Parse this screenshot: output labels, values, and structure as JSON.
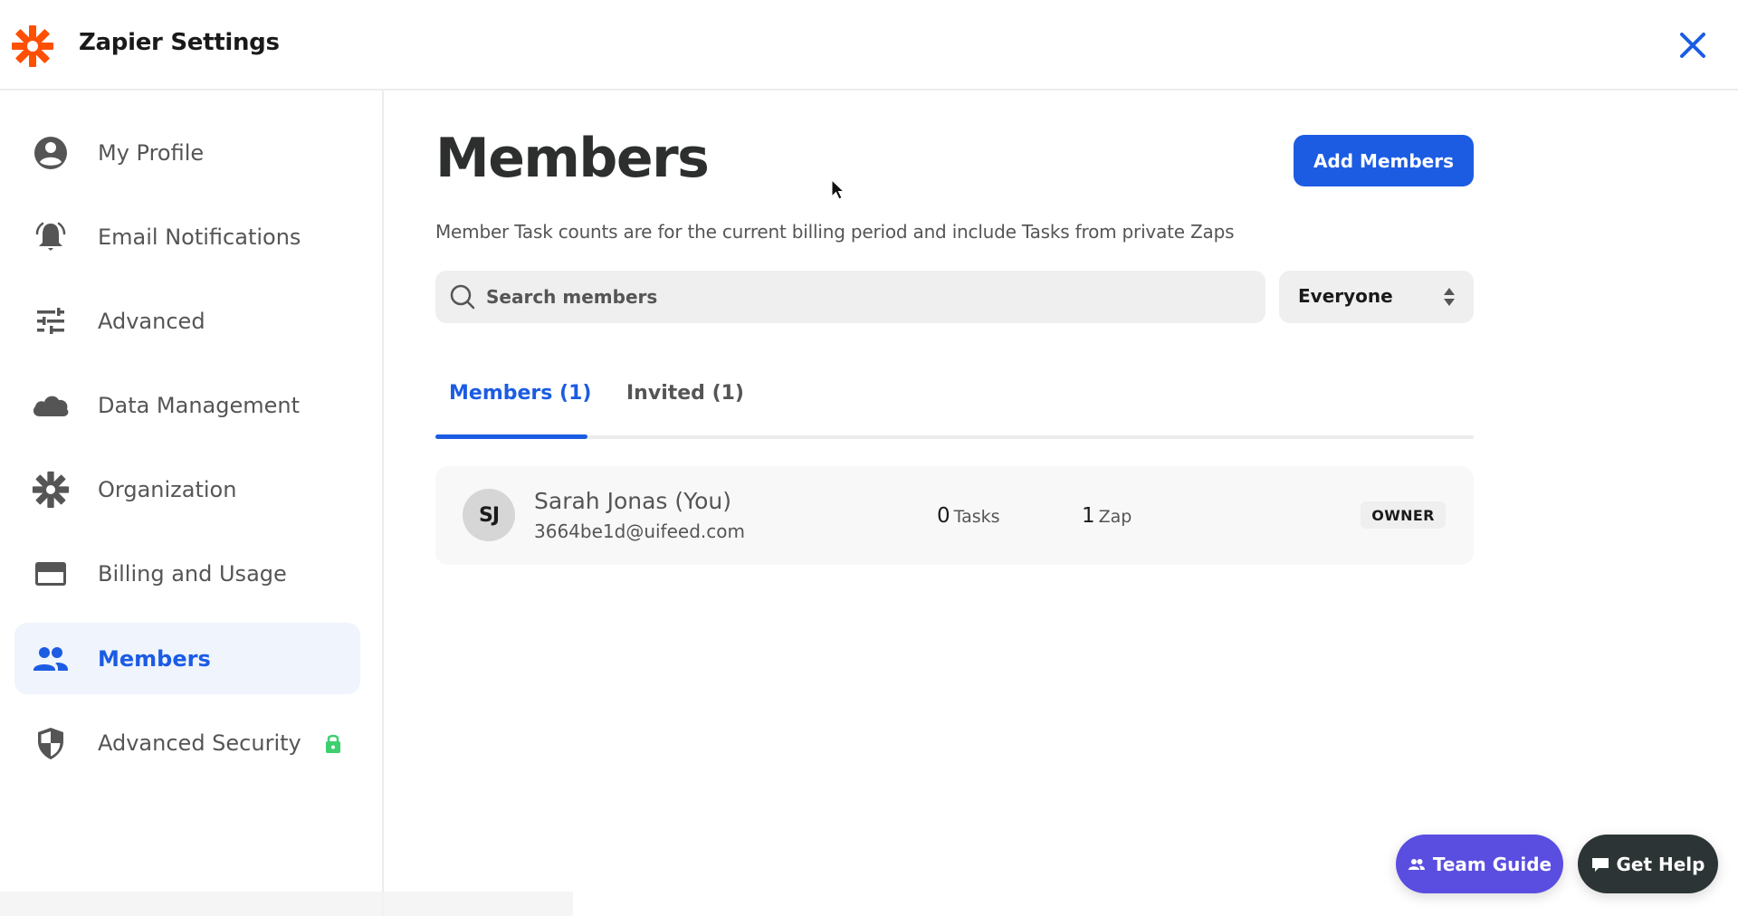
{
  "header": {
    "app_title": "Zapier Settings",
    "logo_icon": "zapier-asterisk-icon",
    "close_icon": "close-icon",
    "brand_color": "#ff4f00"
  },
  "sidebar": {
    "items": [
      {
        "label": "My Profile",
        "icon": "user-circle-icon",
        "active": false
      },
      {
        "label": "Email Notifications",
        "icon": "bell-ringing-icon",
        "active": false
      },
      {
        "label": "Advanced",
        "icon": "sliders-icon",
        "active": false
      },
      {
        "label": "Data Management",
        "icon": "cloud-icon",
        "active": false
      },
      {
        "label": "Organization",
        "icon": "asterisk-icon",
        "active": false
      },
      {
        "label": "Billing and Usage",
        "icon": "credit-card-icon",
        "active": false
      },
      {
        "label": "Members",
        "icon": "people-icon",
        "active": true
      },
      {
        "label": "Advanced Security",
        "icon": "shield-icon",
        "active": false,
        "badge_icon": "lock-icon"
      }
    ],
    "active_color": "#1c5ce3",
    "lock_color": "#3ecf6f"
  },
  "main": {
    "title": "Members",
    "add_button_label": "Add Members",
    "subtitle": "Member Task counts are for the current billing period and include Tasks from private Zaps",
    "search": {
      "placeholder": "Search members",
      "value": ""
    },
    "filter": {
      "selected": "Everyone"
    },
    "tabs": [
      {
        "label": "Members (1)",
        "active": true
      },
      {
        "label": "Invited (1)",
        "active": false
      }
    ],
    "members": [
      {
        "initials": "SJ",
        "name": "Sarah Jonas (You)",
        "email": "3664be1d@uifeed.com",
        "tasks_count": "0",
        "tasks_label": "Tasks",
        "zaps_count": "1",
        "zaps_label": "Zap",
        "role": "OWNER"
      }
    ]
  },
  "floating": {
    "team_guide_label": "Team Guide",
    "get_help_label": "Get Help",
    "team_guide_color": "#5a4ee0",
    "get_help_color": "#2d3436"
  }
}
